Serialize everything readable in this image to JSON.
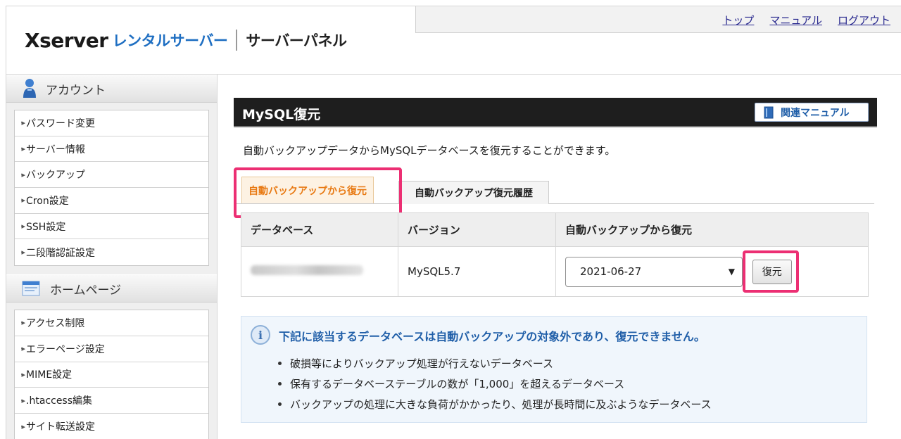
{
  "header": {
    "logo_xserver": "Xserver",
    "logo_rental": "レンタルサーバー",
    "logo_panel": "サーバーパネル",
    "links": [
      "トップ",
      "マニュアル",
      "ログアウト"
    ]
  },
  "sidebar": {
    "sections": [
      {
        "title": "アカウント",
        "items": [
          "パスワード変更",
          "サーバー情報",
          "バックアップ",
          "Cron設定",
          "SSH設定",
          "二段階認証設定"
        ]
      },
      {
        "title": "ホームページ",
        "items": [
          "アクセス制限",
          "エラーページ設定",
          "MIME設定",
          ".htaccess編集",
          "サイト転送設定"
        ]
      }
    ]
  },
  "main": {
    "title": "MySQL復元",
    "manual_button": "関連マニュアル",
    "description": "自動バックアップデータからMySQLデータベースを復元することができます。",
    "tabs": [
      "自動バックアップから復元",
      "自動バックアップ復元履歴"
    ],
    "table": {
      "headers": [
        "データベース",
        "バージョン",
        "自動バックアップから復元"
      ],
      "rows": [
        {
          "version": "MySQL5.7",
          "selected_date": "2021-06-27"
        }
      ],
      "restore_button": "復元"
    },
    "info": {
      "title": "下記に該当するデータベースは自動バックアップの対象外であり、復元できません。",
      "items": [
        "破損等によりバックアップ処理が行えないデータベース",
        "保有するデータベーステーブルの数が「1,000」を超えるデータベース",
        "バックアップの処理に大きな負荷がかかったり、処理が長時間に及ぶようなデータベース"
      ]
    }
  },
  "colors": {
    "highlight": "#ec2f73",
    "active_tab_text": "#e87912",
    "brand_blue": "#1f6fc2"
  }
}
